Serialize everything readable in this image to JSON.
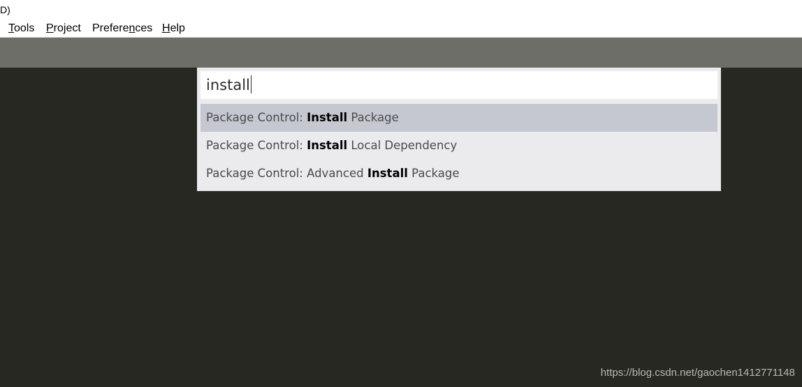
{
  "window": {
    "title": "D)"
  },
  "menu": [
    {
      "pre": "",
      "mn": "T",
      "post": "ools"
    },
    {
      "pre": "",
      "mn": "P",
      "post": "roject"
    },
    {
      "pre": "Prefere",
      "mn": "n",
      "post": "ces"
    },
    {
      "pre": "",
      "mn": "H",
      "post": "elp"
    }
  ],
  "palette": {
    "query": "install",
    "results": [
      {
        "pre": "Package Control: ",
        "match": "Install",
        "post": " Package",
        "selected": true
      },
      {
        "pre": "Package Control: ",
        "match": "Install",
        "post": " Local Dependency",
        "selected": false
      },
      {
        "pre": "Package Control: Advanced ",
        "match": "Install",
        "post": " Package",
        "selected": false
      }
    ]
  },
  "watermark": "https://blog.csdn.net/gaochen1412771148",
  "colors": {
    "editor_bg": "#272822",
    "tabbar_bg": "#6e6e68",
    "palette_bg": "#ebebed",
    "selected_bg": "#c5c8d0"
  }
}
